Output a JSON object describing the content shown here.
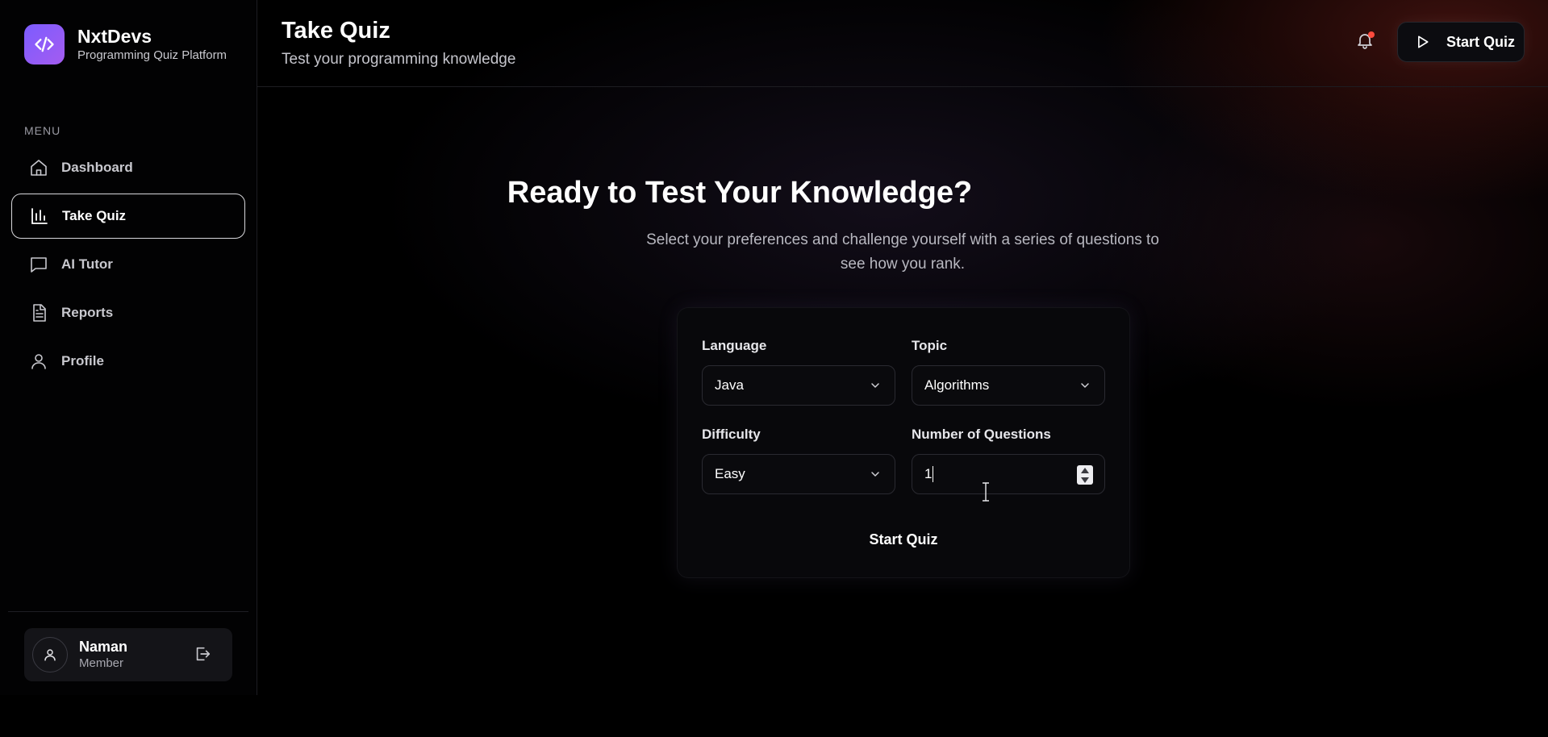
{
  "brand": {
    "name": "NxtDevs",
    "subtitle": "Programming Quiz Platform"
  },
  "sidebar": {
    "menu_label": "MENU",
    "items": [
      {
        "label": "Dashboard",
        "icon": "home-icon",
        "active": false
      },
      {
        "label": "Take Quiz",
        "icon": "bar-chart-icon",
        "active": true
      },
      {
        "label": "AI Tutor",
        "icon": "chat-icon",
        "active": false
      },
      {
        "label": "Reports",
        "icon": "document-icon",
        "active": false
      },
      {
        "label": "Profile",
        "icon": "user-icon",
        "active": false
      }
    ],
    "user": {
      "name": "Naman",
      "role": "Member"
    }
  },
  "header": {
    "title": "Take Quiz",
    "subtitle": "Test your programming knowledge",
    "start_button": "Start Quiz"
  },
  "main": {
    "heading": "Ready to Test Your Knowledge?",
    "description": "Select your preferences and challenge yourself with a series of questions to see how you rank.",
    "form": {
      "language_label": "Language",
      "language_value": "Java",
      "topic_label": "Topic",
      "topic_value": "Algorithms",
      "difficulty_label": "Difficulty",
      "difficulty_value": "Easy",
      "questions_label": "Number of Questions",
      "questions_value": "1",
      "submit_label": "Start Quiz"
    }
  },
  "colors": {
    "accent": "#7c5cff",
    "notification_dot": "#ff4a3d",
    "background": "#000000"
  }
}
